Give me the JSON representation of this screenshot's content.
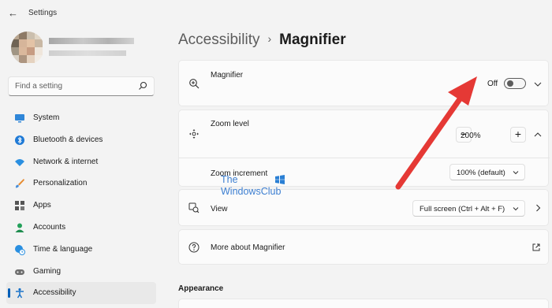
{
  "window": {
    "title": "Settings",
    "back_glyph": "←"
  },
  "search": {
    "placeholder": "Find a setting"
  },
  "sidebar": {
    "items": [
      {
        "label": "System",
        "icon": "monitor-icon",
        "active": false
      },
      {
        "label": "Bluetooth & devices",
        "icon": "bluetooth-icon",
        "active": false
      },
      {
        "label": "Network & internet",
        "icon": "wifi-icon",
        "active": false
      },
      {
        "label": "Personalization",
        "icon": "brush-icon",
        "active": false
      },
      {
        "label": "Apps",
        "icon": "apps-icon",
        "active": false
      },
      {
        "label": "Accounts",
        "icon": "person-icon",
        "active": false
      },
      {
        "label": "Time & language",
        "icon": "globe-clock-icon",
        "active": false
      },
      {
        "label": "Gaming",
        "icon": "controller-icon",
        "active": false
      },
      {
        "label": "Accessibility",
        "icon": "accessibility-icon",
        "active": true
      }
    ]
  },
  "header": {
    "parent": "Accessibility",
    "separator": "›",
    "current": "Magnifier"
  },
  "magnifier": {
    "label": "Magnifier",
    "toggle_state": "Off"
  },
  "zoom": {
    "label": "Zoom level",
    "value": "200%",
    "minus": "−",
    "plus": "+",
    "increment_label": "Zoom increment",
    "increment_value": "100% (default)"
  },
  "view": {
    "label": "View",
    "value": "Full screen (Ctrl + Alt + F)"
  },
  "more": {
    "label": "More about Magnifier"
  },
  "appearance": {
    "title": "Appearance"
  },
  "watermark": {
    "line1": "The",
    "line2": "WindowsClub"
  },
  "colors": {
    "accent": "#005fb8",
    "arrow": "#e53935",
    "background": "#f3f3f3",
    "card": "#fbfbfb"
  }
}
